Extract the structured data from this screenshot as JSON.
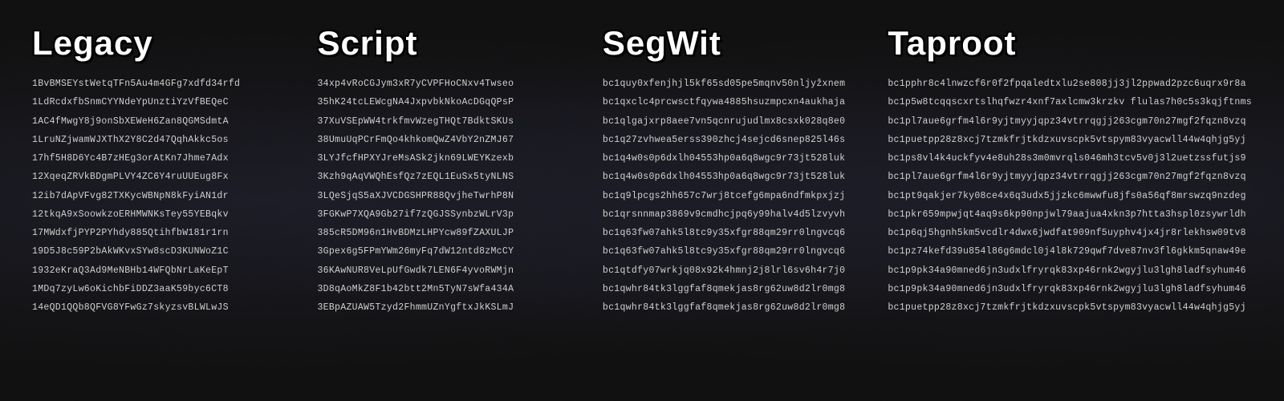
{
  "columns": [
    {
      "id": "legacy",
      "title": "Legacy",
      "addresses": [
        "1BvBMSEYstWetqTFn5Au4m4GFg7xdfd34rfd",
        "1LdRcdxfbSnmCYYNdeYpUnztiYzVfBEQeC",
        "1AC4fMwgY8j9onSbXEWeH6Zan8QGMSdmtA",
        "1LruNZjwamWJXThX2Y8C2d47QqhAkkc5os",
        "17hf5H8D6Yc4B7zHEg3orAtKn7Jhme7Adx",
        "12XqeqZRVkBDgmPLVY4ZC6Y4ruUUEug8Fx",
        "12ib7dApVFvg82TXKycWBNpN8kFyiAN1dr",
        "12tkqA9xSoowkzoERHMWNKsTey55YEBqkv",
        "17MWdxfjPYP2PYhdy885QtihfbW181r1rn",
        "19D5J8c59P2bAkWKvxSYw8scD3KUNWoZ1C",
        "1932eKraQ3Ad9MeNBHb14WFQbNrLaKeEpT",
        "1MDq7zyLw6oKichbFiDDZ3aaK59byc6CT8",
        "14eQD1QQb8QFVG8YFwGz7skyzsvBLWLwJS"
      ]
    },
    {
      "id": "script",
      "title": "Script",
      "addresses": [
        "34xp4vRoCGJym3xR7yCVPFHoCNxv4Twseo",
        "35hK24tcLEWcgNA4JxpvbkNkoAcDGqQPsP",
        "37XuVSEpWW4trkfmvWzegTHQt7BdktSKUs",
        "38UmuUqPCrFmQo4khkomQwZ4VbY2nZMJ67",
        "3LYJfcfHPXYJreMsASk2jkn69LWEYKzexb",
        "3Kzh9qAqVWQhEsfQz7zEQL1EuSx5tyNLNS",
        "3LQeSjqS5aXJVCDGSHPR88QvjheTwrhP8N",
        "3FGKwP7XQA9Gb27if7zQGJSSynbzWLrV3p",
        "385cR5DM96n1HvBDMzLHPYcw89fZAXULJP",
        "3Gpex6g5FPmYWm26myFq7dW12ntd8zMcCY",
        "36KAwNUR8VeLpUfGwdk7LEN6F4yvoRWMjn",
        "3D8qAoMkZ8F1b42btt2Mn5TyN7sWfa434A",
        "3EBpAZUAW5Tzyd2FhmmUZnYgftxJkKSLmJ"
      ]
    },
    {
      "id": "segwit",
      "title": "SegWit",
      "addresses": [
        "bc1quy0xfenjhjl5kf65sd05pe5mqnv50nljyžxnem",
        "bc1qxclc4prcwsctfqywa4885hsuzmpcxn4aukhaja",
        "bc1qlgajxrp8aee7vn5qcnrujudlmx8csxk028q8e0",
        "bc1q27zvhwea5erss390zhcj4sejcd6snep825l46s",
        "bc1q4w0s0p6dxlh04553hp0a6q8wgc9r73jt528luk",
        "bc1q4w0s0p6dxlh04553hp0a6q8wgc9r73jt528luk",
        "bc1q9lpcgs2hh657c7wrj8tcefg6mpa6ndfmkpxjzj",
        "bc1qrsnnmap3869v9cmdhcjpq6y99halv4d5lzvyvh",
        "bc1q63fw07ahk5l8tc9y35xfgr88qm29rr0lngvcq6",
        "bc1q63fw07ahk5l8tc9y35xfgr88qm29rr0lngvcq6",
        "bc1qtdfy07wrkjq08x92k4hmnj2j8lrl6sv6h4r7j0",
        "bc1qwhr84tk3lggfaf8qmekjas8rg62uw8d2lr0mg8",
        "bc1qwhr84tk3lggfaf8qmekjas8rg62uw8d2lr0mg8"
      ]
    },
    {
      "id": "taproot",
      "title": "Taproot",
      "addresses": [
        "bc1pphr8c4lnwzcf6r0f2fpqaledtxlu2se808jj3jl2ppwad2pzc6uqrx9r8a",
        "bc1p5w8tcqqscxrtslhqfwzr4xnf7axlcmw3krzkv flulas7h0c5s3kqjftnms",
        "bc1pl7aue6grfm4l6r9yjtmyyjqpz34vtrrqgjj263cgm70n27mgf2fqzn8vzq",
        "bc1puetpp28z8xcj7tzmkfrjtkdzxuvscpk5vtspym83vyacwll44w4qhjg5yj",
        "bc1ps8vl4k4uckfyv4e8uh28s3m0mvrqls046mh3tcv5v0j3l2uetzssfutjs9",
        "bc1pl7aue6grfm4l6r9yjtmyyjqpz34vtrrqgjj263cgm70n27mgf2fqzn8vzq",
        "bc1pt9qakjer7ky08ce4x6q3udx5jjzkc6mwwfu8jfs0a56qf8mrswzq9nzdeg",
        "bc1pkr659mpwjqt4aq9s6kp90npjwl79aajua4xkn3p7htta3hspl0zsywrldh",
        "bc1p6qj5hgnh5km5vcdlr4dwx6jwdfat909nf5uyphv4jx4jr8rlekhsw09tv8",
        "bc1pz74kefd39u854l86g6mdcl0j4l8k729qwf7dve87nv3fl6gkkm5qnaw49e",
        "bc1p9pk34a90mned6jn3udxlfryrqk83xp46rnk2wgyjlu3lgh8ladfsyhum46",
        "bc1p9pk34a90mned6jn3udxlfryrqk83xp46rnk2wgyjlu3lgh8ladfsyhum46",
        "bc1puetpp28z8xcj7tzmkfrjtkdzxuvscpk5vtspym83vyacwll44w4qhjg5yj"
      ]
    }
  ]
}
